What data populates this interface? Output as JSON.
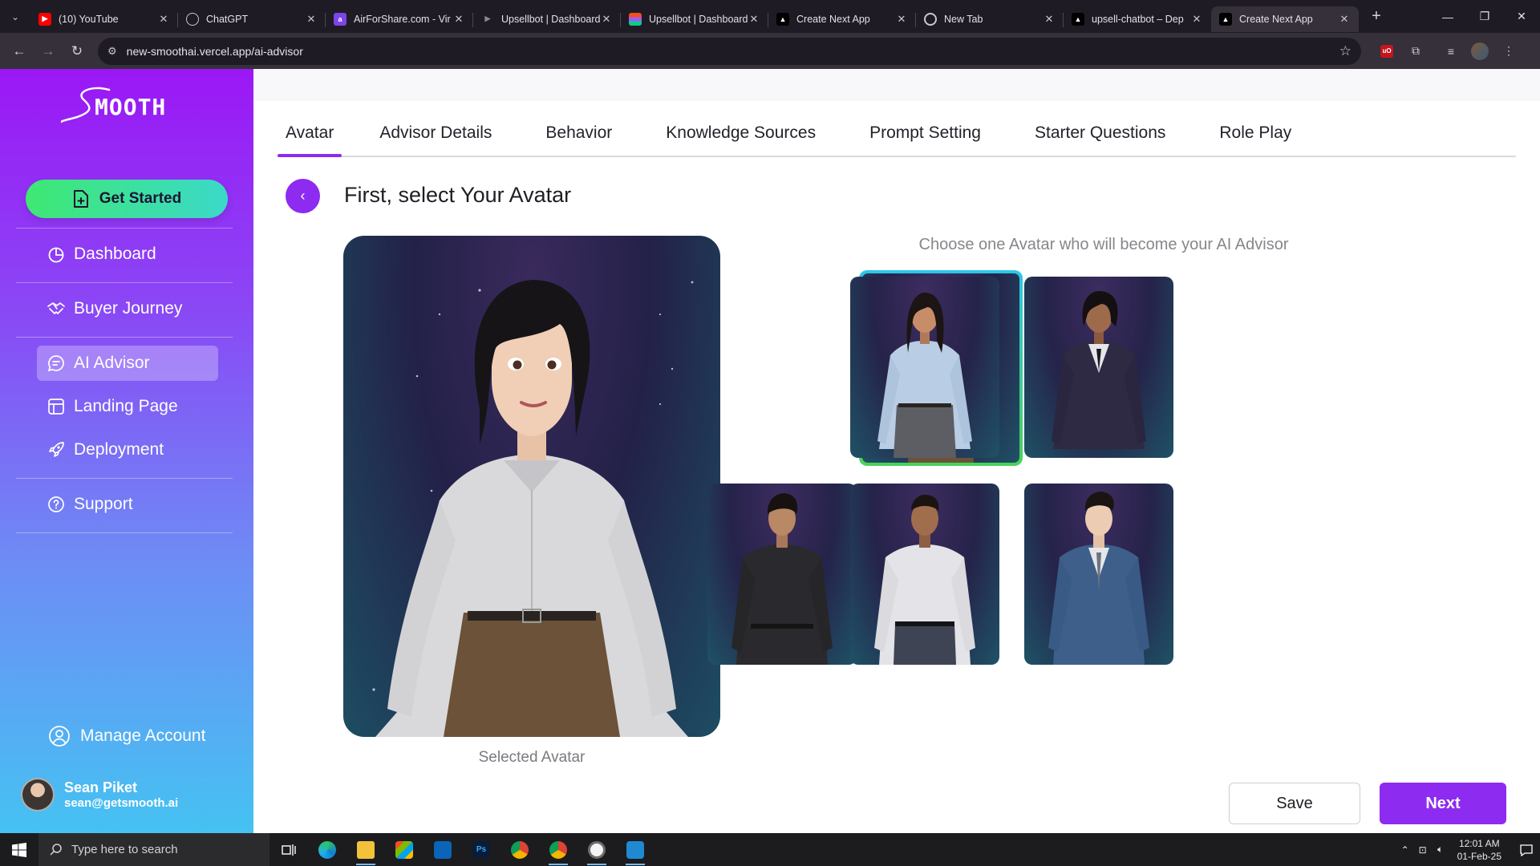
{
  "browser": {
    "tabs": [
      {
        "title": "(10) YouTube",
        "icon": "youtube-icon",
        "color": "#ff0000"
      },
      {
        "title": "ChatGPT",
        "icon": "chatgpt-icon",
        "color": "#5a5a5a"
      },
      {
        "title": "AirForShare.com - Vir",
        "icon": "airforshare-icon",
        "color": "#7b45e8"
      },
      {
        "title": "Upsellbot | Dashboard",
        "icon": "upsellbot-icon",
        "color": "#3a3a3a"
      },
      {
        "title": "Upsellbot | Dashboard",
        "icon": "figma-icon",
        "color": "#a259ff"
      },
      {
        "title": "Create Next App",
        "icon": "vercel-icon",
        "color": "#000000"
      },
      {
        "title": "New Tab",
        "icon": "chrome-icon",
        "color": "#5a5a5a"
      },
      {
        "title": "upsell-chatbot – Dep",
        "icon": "vercel-icon",
        "color": "#000000"
      },
      {
        "title": "Create Next App",
        "icon": "vercel-icon",
        "color": "#000000",
        "active": true
      }
    ],
    "url": "new-smoothai.vercel.app/ai-advisor"
  },
  "sidebar": {
    "brand": "MOOTH",
    "get_started": "Get Started",
    "items": [
      {
        "label": "Dashboard",
        "icon": "pie-chart-icon"
      },
      {
        "label": "Buyer Journey",
        "icon": "handshake-icon"
      },
      {
        "label": "AI Advisor",
        "icon": "chat-bubble-icon",
        "active": true
      },
      {
        "label": "Landing Page",
        "icon": "layout-icon"
      },
      {
        "label": "Deployment",
        "icon": "rocket-icon"
      },
      {
        "label": "Support",
        "icon": "help-circle-icon"
      }
    ],
    "manage_account": "Manage Account",
    "user": {
      "name": "Sean Piket",
      "email": "sean@getsmooth.ai"
    }
  },
  "main": {
    "tabs": [
      "Avatar",
      "Advisor Details",
      "Behavior",
      "Knowledge Sources",
      "Prompt Setting",
      "Starter Questions",
      "Role Play"
    ],
    "active_tab": "Avatar",
    "title": "First, select Your Avatar",
    "selected_caption": "Selected Avatar",
    "choose_caption": "Choose one Avatar who will become your AI Advisor",
    "avatars": [
      {
        "name": "female-casual-white-shirt",
        "selected": true
      },
      {
        "name": "female-blue-shirt"
      },
      {
        "name": "female-suit"
      },
      {
        "name": "male-black-shirt"
      },
      {
        "name": "male-white-shirt"
      },
      {
        "name": "male-blue-suit"
      }
    ],
    "save": "Save",
    "next": "Next"
  },
  "taskbar": {
    "search_placeholder": "Type here to search",
    "time": "12:01 AM",
    "date": "01-Feb-25"
  },
  "colors": {
    "accent": "#8d2bf0",
    "sidebar_top": "#9b17f5",
    "sidebar_bottom": "#45c2f2",
    "get_started_start": "#3ee872",
    "get_started_end": "#3bd9c9"
  }
}
